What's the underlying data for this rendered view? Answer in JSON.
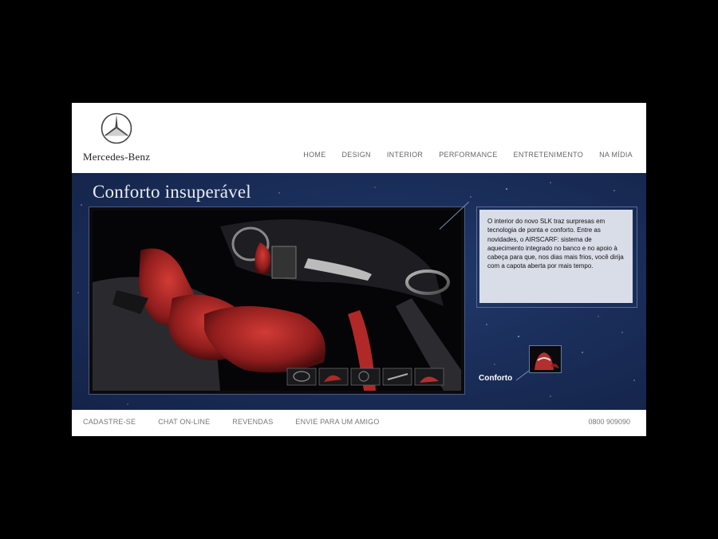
{
  "header": {
    "brand": "Mercedes-Benz",
    "nav": [
      "HOME",
      "DESIGN",
      "INTERIOR",
      "PERFORMANCE",
      "ENTRETENIMENTO",
      "NA MÍDIA"
    ]
  },
  "hero": {
    "title": "Conforto insuperável",
    "info_text": "O interior do novo SLK  traz surpresas em  tecnologia de ponta e conforto. Entre as novidades, o AIRSCARF: sistema de aquecimento integrado no banco e no apoio à cabeça para que, nos dias mais frios, você dirija com a capota aberta por mais tempo.",
    "thumb_label": "Conforto"
  },
  "footer": {
    "links": [
      "CADASTRE-SE",
      "CHAT ON-LINE",
      "REVENDAS",
      "ENVIE PARA UM AMIGO"
    ],
    "phone": "0800 909090"
  },
  "colors": {
    "hero_bg": "#1b2f5c",
    "info_bg": "#d9dde7",
    "seat_red": "#b02828"
  }
}
